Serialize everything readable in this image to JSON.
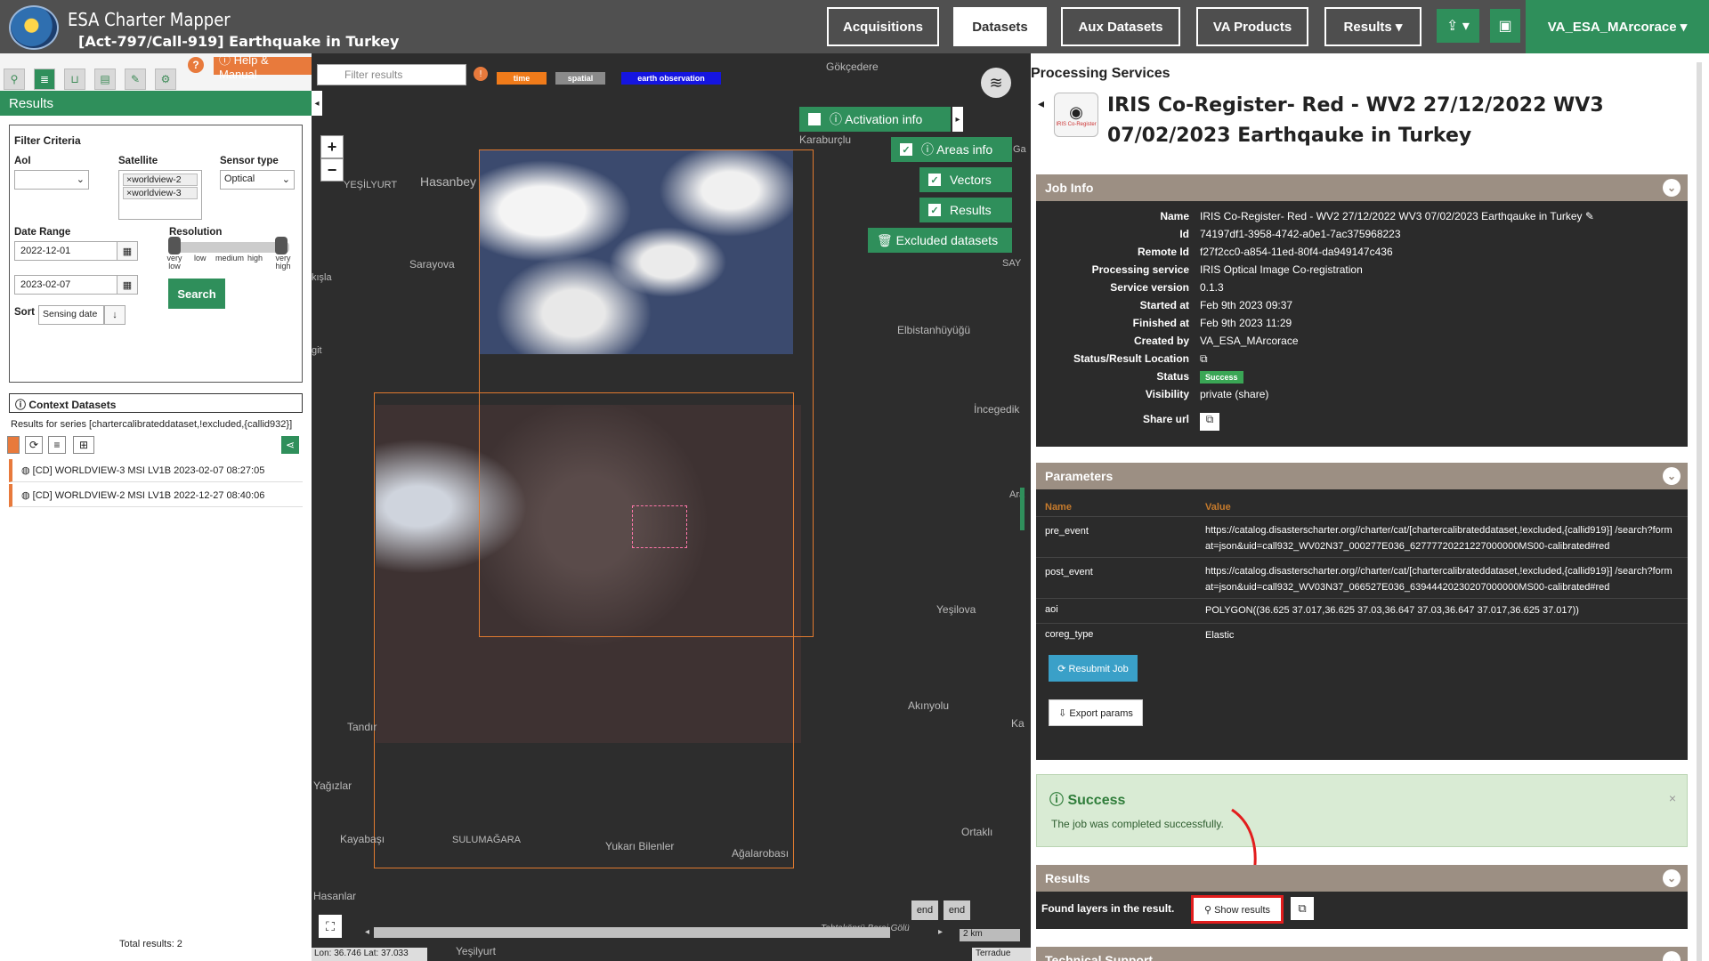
{
  "app": {
    "title": "ESA Charter Mapper",
    "activation": "[Act-797/Call-919] Earthquake in Turkey"
  },
  "nav": {
    "acquisitions": "Acquisitions",
    "datasets": "Datasets",
    "aux": "Aux Datasets",
    "va": "VA Products",
    "results": "Results ▾",
    "upload": "⇪ ▾",
    "briefcase": "▣",
    "user": "VA_ESA_MArcorace ▾"
  },
  "left": {
    "help": "ⓘ Help & Manual",
    "help_q": "?",
    "results_title": "Results",
    "filter_title": "Filter Criteria",
    "aoi_label": "AoI",
    "satellite_label": "Satellite",
    "satellite_chips": [
      "×worldview-2",
      "×worldview-3"
    ],
    "sensor_label": "Sensor type",
    "sensor_value": "Optical",
    "date_label": "Date Range",
    "date_from": "2022-12-01",
    "date_to": "2023-02-07",
    "resolution_label": "Resolution",
    "res_labels": [
      "very low",
      "low",
      "medium",
      "high",
      "very high"
    ],
    "search": "Search",
    "sort_label": "Sort",
    "sort_value": "Sensing date",
    "context_title": "ⓘ Context Datasets",
    "series_text": "Results for series [chartercalibrateddataset,!excluded,{callid932}]",
    "datasets": [
      "[CD] WORLDVIEW-3 MSI LV1B 2023-02-07 08:27:05",
      "[CD] WORLDVIEW-2 MSI LV1B 2022-12-27 08:40:06"
    ],
    "total": "Total results: 2"
  },
  "map": {
    "filter_placeholder": "Filter results",
    "tags": {
      "time": "time",
      "spatial": "spatial",
      "eo": "earth observation"
    },
    "zoom_in": "+",
    "zoom_out": "−",
    "layers": {
      "activation": "ⓘ Activation info",
      "areas": "ⓘ Areas info",
      "vectors": "Vectors",
      "results": "Results",
      "excluded": "🗑 Excluded datasets"
    },
    "places": [
      "Gökçedere",
      "Karaburçlu",
      "Hasanbey",
      "YEŞİLYURT",
      "Sarayova",
      "Elbistanhüyüğü",
      "İncegedik",
      "Yeşilova",
      "Akınyolu",
      "Tandır",
      "Yağızlar",
      "Kayabaşı",
      "SULUMAĞARA",
      "Yukarı Bilenler",
      "Ağalarobası",
      "Ortaklı",
      "Hasanlar",
      "Yeşilyurt",
      "Tahtaköprü Baraj Gölü",
      "SAY",
      "Ga",
      "Ara",
      "Ka",
      "kışla",
      "git"
    ],
    "end": "end",
    "scale": "2 km",
    "coords": "Lon: 36.746 Lat: 37.033",
    "attribution": "Terradue"
  },
  "right": {
    "section_title": "Processing Services",
    "job_title": "IRIS Co-Register- Red - WV2 27/12/2022 WV3 07/02/2023 Earthqauke in Turkey",
    "icon_label": "IRIS Co-Register",
    "jobinfo_title": "Job Info",
    "jobinfo": [
      {
        "k": "Name",
        "v": "IRIS Co-Register- Red - WV2 27/12/2022 WV3 07/02/2023 Earthqauke in Turkey ✎"
      },
      {
        "k": "Id",
        "v": "74197df1-3958-4742-a0e1-7ac375968223"
      },
      {
        "k": "Remote Id",
        "v": "f27f2cc0-a854-11ed-80f4-da949147c436"
      },
      {
        "k": "Processing service",
        "v": "IRIS Optical Image Co-registration"
      },
      {
        "k": "Service version",
        "v": "0.1.3"
      },
      {
        "k": "Started at",
        "v": "Feb 9th 2023 09:37"
      },
      {
        "k": "Finished at",
        "v": "Feb 9th 2023 11:29"
      },
      {
        "k": "Created by",
        "v": "VA_ESA_MArcorace"
      },
      {
        "k": "Status/Result Location",
        "v": "⧉"
      }
    ],
    "status_label": "Status",
    "status_value": "Success",
    "visibility_label": "Visibility",
    "visibility_value": "private (share)",
    "shareurl_label": "Share url",
    "params_title": "Parameters",
    "params_head": {
      "name": "Name",
      "value": "Value"
    },
    "params": [
      {
        "n": "pre_event",
        "v": "https://catalog.disasterscharter.org//charter/cat/[chartercalibrateddataset,!excluded,{callid919}] /search?format=json&uid=call932_WV02N37_000277E036_62777720221227000000MS00-calibrated#red"
      },
      {
        "n": "post_event",
        "v": "https://catalog.disasterscharter.org//charter/cat/[chartercalibrateddataset,!excluded,{callid919}] /search?format=json&uid=call932_WV03N37_066527E036_63944420230207000000MS00-calibrated#red"
      },
      {
        "n": "aoi",
        "v": "POLYGON((36.625 37.017,36.625 37.03,36.647 37.03,36.647 37.017,36.625 37.017))"
      },
      {
        "n": "coreg_type",
        "v": "Elastic"
      }
    ],
    "resubmit": "⟳ Resubmit Job",
    "export": "⇩ Export params",
    "success_title": "ⓘ Success",
    "success_msg": "The job was completed successfully.",
    "results_title": "Results",
    "found_text": "Found layers in the result.",
    "show_results": "⚲ Show results",
    "tech_title": "Technical Support"
  }
}
